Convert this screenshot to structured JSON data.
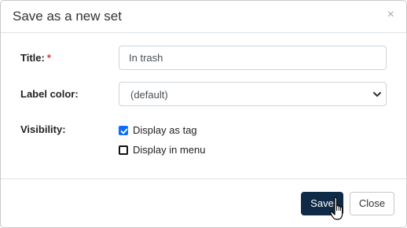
{
  "dialog": {
    "title": "Save as a new set",
    "close_icon": "×"
  },
  "form": {
    "title_label": "Title:",
    "required_mark": "*",
    "title_value": "In trash",
    "label_color_label": "Label color:",
    "label_color_value": "(default)",
    "visibility_label": "Visibility:",
    "options": [
      {
        "label": "Display as tag",
        "checked": true
      },
      {
        "label": "Display in menu",
        "checked": false
      }
    ]
  },
  "footer": {
    "save_label": "Save",
    "close_label": "Close"
  },
  "colors": {
    "primary_button": "#0e2a47",
    "checkbox_checked": "#0d6efd",
    "required": "#dc3545"
  },
  "icons": [
    "close-icon",
    "chevron-down-icon",
    "checkmark-icon",
    "hand-pointer-icon"
  ]
}
